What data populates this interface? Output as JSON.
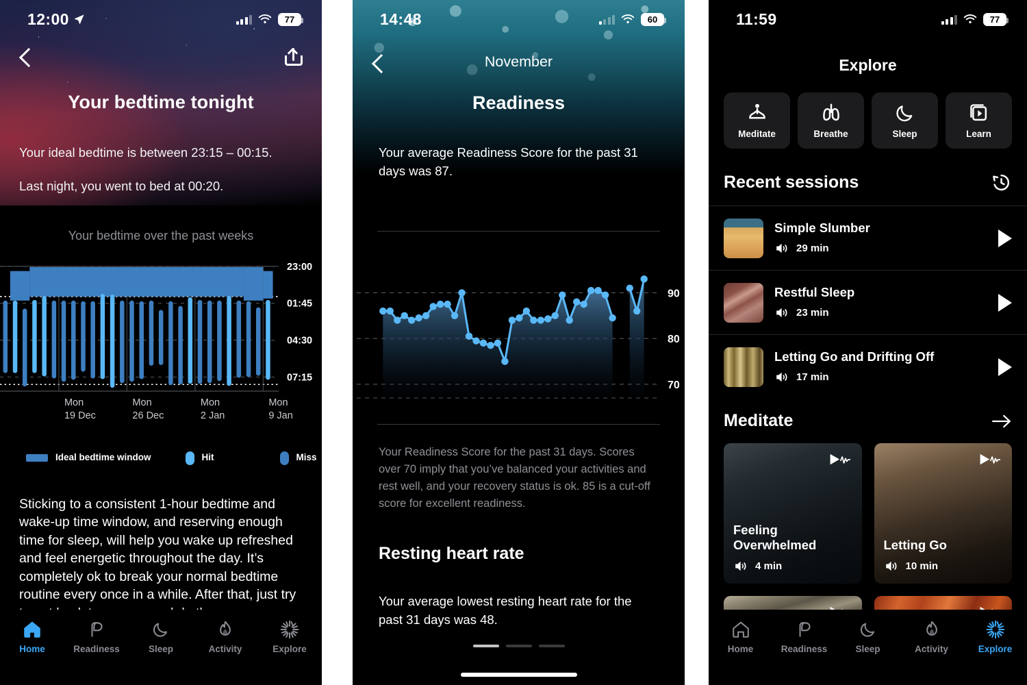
{
  "panel1": {
    "status": {
      "time": "12:00",
      "battery": "77",
      "location_icon": "location-arrow-icon",
      "wifi_icon": "wifi-icon",
      "signal_icon": "cellular-signal-icon"
    },
    "nav": {
      "back_icon": "chevron-left-icon",
      "share_icon": "share-icon"
    },
    "title": "Your bedtime tonight",
    "subtitle_1": "Your ideal bedtime is between 23:15 – 00:15.",
    "subtitle_2": "Last night, you went to bed at 00:20.",
    "chart_title": "Your bedtime over the past weeks",
    "legend": [
      {
        "label": "Ideal bedtime window",
        "color": "#3e7fc1",
        "shape": "bar"
      },
      {
        "label": "Hit",
        "color": "#5ab8f7",
        "shape": "pill"
      },
      {
        "label": "Miss",
        "color": "#3e7fc1",
        "shape": "pill"
      }
    ],
    "body": "Sticking to a consistent 1-hour bedtime and wake-up time window, and reserving enough time for sleep, will help you wake up refreshed and feel energetic throughout the day. It’s completely ok to break your normal bedtime routine every once in a while. After that, just try to get back to your normal rhythm.",
    "tabs": [
      {
        "label": "Home",
        "icon": "home-icon",
        "active": true
      },
      {
        "label": "Readiness",
        "icon": "leaf-icon",
        "active": false
      },
      {
        "label": "Sleep",
        "icon": "moon-icon",
        "active": false
      },
      {
        "label": "Activity",
        "icon": "flame-icon",
        "active": false
      },
      {
        "label": "Explore",
        "icon": "sparkle-icon",
        "active": false
      }
    ]
  },
  "panel2": {
    "status": {
      "time": "14:48",
      "battery": "60",
      "wifi_icon": "wifi-icon",
      "signal_icon": "cellular-signal-icon"
    },
    "nav": {
      "back_icon": "chevron-left-icon"
    },
    "month": "November",
    "title": "Readiness",
    "subtitle": "Your average Readiness Score for the past 31 days was 87.",
    "note": "Your Readiness Score for the past 31 days. Scores over 70 imply that you’ve balanced your activities and rest well, and your recovery status is ok. 85 is a cut-off score for excellent readiness.",
    "heading2": "Resting heart rate",
    "rhr_text": "Your average lowest resting heart rate for the past 31 days was 48.",
    "page_dots": [
      true,
      false,
      false
    ]
  },
  "panel3": {
    "status": {
      "time": "11:59",
      "battery": "77",
      "wifi_icon": "wifi-icon",
      "signal_icon": "cellular-signal-icon"
    },
    "title": "Explore",
    "quick": [
      {
        "label": "Meditate",
        "icon": "meditate-icon"
      },
      {
        "label": "Breathe",
        "icon": "lungs-icon"
      },
      {
        "label": "Sleep",
        "icon": "moon-icon"
      },
      {
        "label": "Learn",
        "icon": "video-stack-icon"
      }
    ],
    "recent": {
      "title": "Recent sessions",
      "action_icon": "history-clock-icon"
    },
    "sessions": [
      {
        "name": "Simple Slumber",
        "duration": "29 min",
        "audio_icon": "speaker-icon",
        "play_icon": "play-icon",
        "thumb": "th-dune"
      },
      {
        "name": "Restful Sleep",
        "duration": "23 min",
        "audio_icon": "speaker-icon",
        "play_icon": "play-icon",
        "thumb": "th-rest"
      },
      {
        "name": "Letting Go and Drifting Off",
        "duration": "17 min",
        "audio_icon": "speaker-icon",
        "play_icon": "play-icon",
        "thumb": "th-letting"
      }
    ],
    "meditate": {
      "title": "Meditate",
      "action_icon": "arrow-right-icon"
    },
    "meditate_cards": [
      {
        "name": "Feeling Overwhelmed",
        "duration": "4 min",
        "audio_icon": "speaker-icon",
        "badge_icon": "play-waveform-icon",
        "art": "mc-feeling"
      },
      {
        "name": "Letting Go",
        "duration": "10 min",
        "audio_icon": "speaker-icon",
        "badge_icon": "play-waveform-icon",
        "art": "mc-letting"
      }
    ],
    "tabs": [
      {
        "label": "Home",
        "icon": "home-icon",
        "active": false
      },
      {
        "label": "Readiness",
        "icon": "leaf-icon",
        "active": false
      },
      {
        "label": "Sleep",
        "icon": "moon-icon",
        "active": false
      },
      {
        "label": "Activity",
        "icon": "flame-icon",
        "active": false
      },
      {
        "label": "Explore",
        "icon": "sparkle-icon",
        "active": true
      }
    ]
  },
  "chart_data": [
    {
      "id": "bedtime-chart",
      "type": "bar",
      "title": "Your bedtime over the past weeks",
      "ylabel": "",
      "xlabel": "",
      "ytick_labels": [
        "23:00",
        "01:45",
        "04:30",
        "07:15"
      ],
      "ytick_values": [
        23.0,
        25.75,
        28.5,
        31.25
      ],
      "xtick_labels": [
        "Mon\n19 Dec",
        "Mon\n26 Dec",
        "Mon\n2 Jan",
        "Mon\n9 Jan"
      ],
      "xtick_indices": [
        6,
        13,
        20,
        27
      ],
      "ylim": [
        22.6,
        32.4
      ],
      "grid": true,
      "series_colors": {
        "hit": "#5ab8f7",
        "miss": "#3e7fc1",
        "window": "#3e7fc1"
      },
      "ideal_window": {
        "start": "23:15",
        "end": "00:15"
      },
      "bars": [
        {
          "i": 0,
          "bed": 25.55,
          "wake": 30.95,
          "status": "miss"
        },
        {
          "i": 1,
          "bed": 25.55,
          "wake": 30.95,
          "status": "hit"
        },
        {
          "i": 2,
          "bed": 26.15,
          "wake": 31.95,
          "status": "miss"
        },
        {
          "i": 3,
          "bed": 25.5,
          "wake": 30.95,
          "status": "hit"
        },
        {
          "i": 4,
          "bed": 25.2,
          "wake": 31.2,
          "status": "hit"
        },
        {
          "i": 5,
          "bed": 25.55,
          "wake": 31.35,
          "status": "miss"
        },
        {
          "i": 6,
          "bed": 25.55,
          "wake": 31.6,
          "status": "miss"
        },
        {
          "i": 7,
          "bed": 25.55,
          "wake": 31.45,
          "status": "miss"
        },
        {
          "i": 8,
          "bed": 25.6,
          "wake": 30.85,
          "status": "miss"
        },
        {
          "i": 9,
          "bed": 25.6,
          "wake": 31.35,
          "status": "miss"
        },
        {
          "i": 10,
          "bed": 25.05,
          "wake": 31.4,
          "status": "hit"
        },
        {
          "i": 11,
          "bed": 25.1,
          "wake": 32.05,
          "status": "hit"
        },
        {
          "i": 12,
          "bed": 25.55,
          "wake": 31.7,
          "status": "miss"
        },
        {
          "i": 13,
          "bed": 25.55,
          "wake": 31.6,
          "status": "miss"
        },
        {
          "i": 14,
          "bed": 25.6,
          "wake": 31.4,
          "status": "miss"
        },
        {
          "i": 15,
          "bed": 25.55,
          "wake": 30.4,
          "status": "miss"
        },
        {
          "i": 16,
          "bed": 26.25,
          "wake": 30.35,
          "status": "miss"
        },
        {
          "i": 17,
          "bed": 25.6,
          "wake": 31.85,
          "status": "miss"
        },
        {
          "i": 18,
          "bed": 25.95,
          "wake": 31.8,
          "status": "miss"
        },
        {
          "i": 19,
          "bed": 25.3,
          "wake": 31.75,
          "status": "hit"
        },
        {
          "i": 20,
          "bed": 25.5,
          "wake": 31.75,
          "status": "miss"
        },
        {
          "i": 21,
          "bed": 25.55,
          "wake": 31.7,
          "status": "miss"
        },
        {
          "i": 22,
          "bed": 25.55,
          "wake": 31.55,
          "status": "miss"
        },
        {
          "i": 23,
          "bed": 25.2,
          "wake": 31.9,
          "status": "hit"
        },
        {
          "i": 24,
          "bed": 25.55,
          "wake": 31.3,
          "status": "miss"
        },
        {
          "i": 25,
          "bed": 25.6,
          "wake": 31.25,
          "status": "miss"
        },
        {
          "i": 26,
          "bed": 26.05,
          "wake": 31.15,
          "status": "miss"
        },
        {
          "i": 27,
          "bed": 25.5,
          "wake": 31.45,
          "status": "hit"
        }
      ],
      "window_segments": [
        {
          "from": 1,
          "to": 3,
          "top": 23.35,
          "bottom": 25.55
        },
        {
          "from": 3,
          "to": 25,
          "top": 23.05,
          "bottom": 25.25
        },
        {
          "from": 25,
          "to": 27,
          "top": 23.05,
          "bottom": 25.55
        },
        {
          "from": 27,
          "to": 28,
          "top": 23.35,
          "bottom": 25.4
        }
      ]
    },
    {
      "id": "readiness-chart",
      "type": "line",
      "title": "Readiness Score",
      "ylabel": "",
      "xlabel": "",
      "ytick_labels": [
        "90",
        "80",
        "70"
      ],
      "ytick_values": [
        90,
        80,
        70
      ],
      "ylim": [
        67,
        95
      ],
      "grid": true,
      "average": 87,
      "line_color": "#5ab8f7",
      "segments": [
        {
          "values": [
            86,
            86,
            84,
            85,
            84,
            84.5,
            85,
            87,
            87.5,
            87.5,
            85,
            90,
            80.5,
            79.5,
            79,
            78.5,
            79,
            75,
            84,
            84.5,
            86,
            84,
            84,
            84.3,
            85,
            89.5,
            84,
            88,
            87.5,
            90.5,
            90.5,
            89.5,
            84.5
          ]
        },
        {
          "values": [
            91,
            86,
            93
          ]
        }
      ]
    }
  ]
}
